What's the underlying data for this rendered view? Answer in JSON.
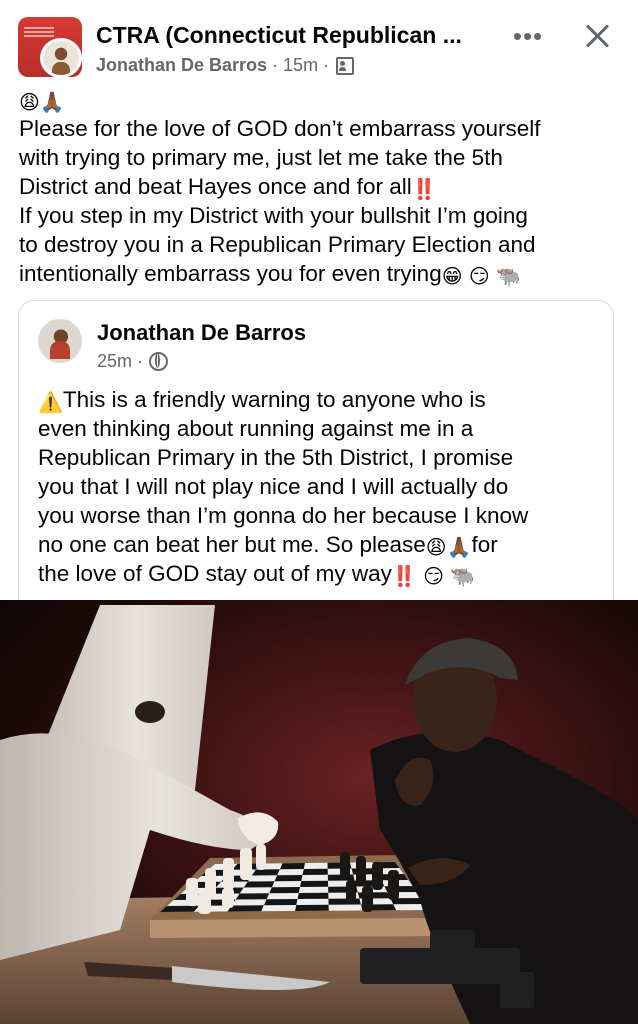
{
  "header": {
    "group_name": "CTRA (Connecticut Republican ...",
    "author": "Jonathan De Barros",
    "time": "15m",
    "separator": "·",
    "privacy_icon": "members-icon",
    "more_label": "•••",
    "close_icon": "close-icon"
  },
  "post": {
    "lines": [
      "Please for the love of GOD don’t embarrass yourself",
      "with trying to primary me, just let me take the 5th",
      "District and beat Hayes once and for all",
      "If you step in my District with your bullshit I’m going",
      "to destroy you in a Republican Primary Election and",
      "intentionally embarrass you for even trying"
    ],
    "emoji": {
      "weary": "😩",
      "pray": "🙏🏾",
      "bangbang": "‼️",
      "grin": "😁",
      "smirk": "😏",
      "water_buffalo": "🐃"
    }
  },
  "shared": {
    "author": "Jonathan De Barros",
    "time": "25m",
    "separator": "·",
    "privacy_icon": "globe-icon",
    "lines": [
      "This is a friendly warning to anyone who is",
      "even thinking about running against me in a",
      "Republican Primary in the 5th District, I promise",
      "you that I will not play nice and I will actually do",
      "you worse than I’m gonna do her because I know",
      "no one can beat her but me. So please",
      "for",
      "the love of GOD stay out of my way"
    ],
    "emoji": {
      "warning": "⚠️",
      "weary": "😩",
      "pray": "🙏🏾",
      "bangbang": "‼️",
      "smirk": "😏",
      "water_buffalo": "🐃"
    }
  },
  "image": {
    "subject": "chess-match-illustration"
  }
}
